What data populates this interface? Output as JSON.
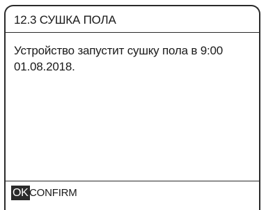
{
  "header": {
    "title": "12.3 СУШКА ПОЛА"
  },
  "message": {
    "lines": [
      "Устройство запустит сушку пола в 9:00",
      "01.08.2018."
    ]
  },
  "footer": {
    "ok_key_label": "OK",
    "confirm_label": "CONFIRM"
  }
}
